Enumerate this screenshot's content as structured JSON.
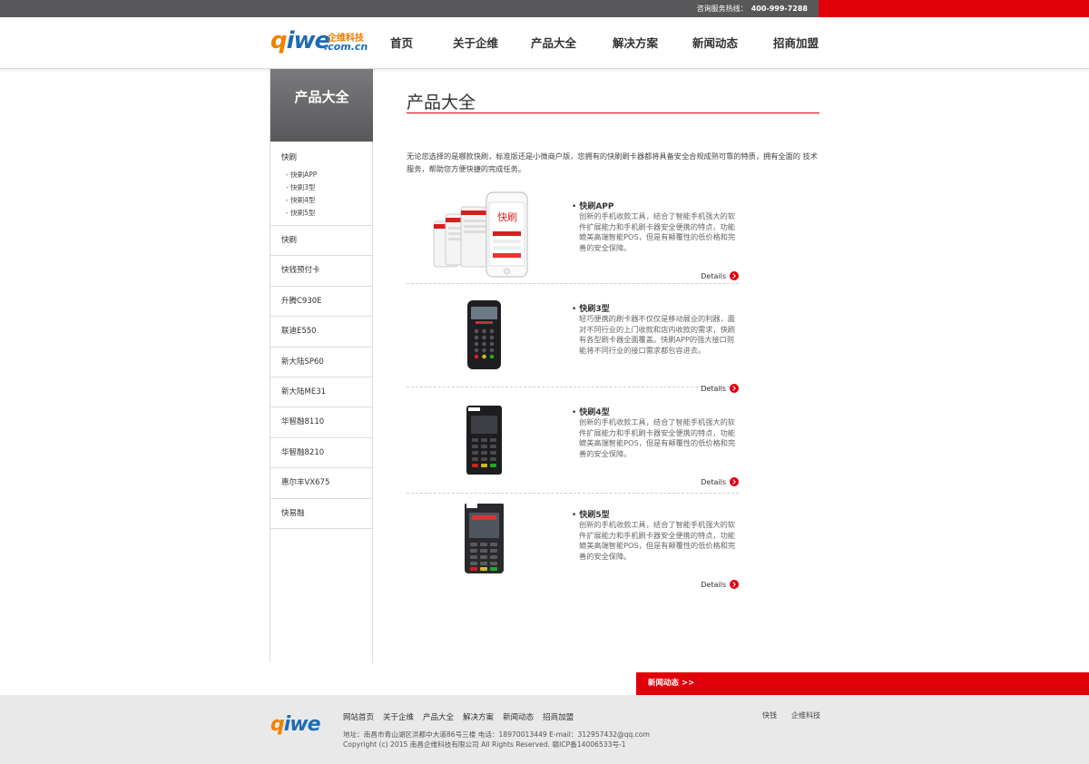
{
  "topbar": {
    "hotline_label": "咨询服务热线：",
    "hotline_number": "400-999-7288"
  },
  "logo": {
    "main": "qiwe",
    "cn": "企维科技",
    "domain": ".com.cn"
  },
  "nav": [
    "首页",
    "关于企维",
    "产品大全",
    "解决方案",
    "新闻动态",
    "招商加盟"
  ],
  "sidebar": {
    "title": "产品大全",
    "group": {
      "title": "快刷",
      "items": [
        "- 快刷APP",
        "- 快刷3型",
        "- 快刷4型",
        "- 快刷5型"
      ]
    },
    "items": [
      "快刷",
      "快钱预付卡",
      "升腾C930E",
      "联迪E550",
      "新大陆SP60",
      "新大陆ME31",
      "华智融8110",
      "华智融8210",
      "惠尔丰VX675",
      "快易融"
    ]
  },
  "main": {
    "title": "产品大全",
    "intro": "无论您选择的是哪款快刷，标准版还是小微商户版，您拥有的快刷刷卡器都将具备安全合规成熟可靠的特质，拥有全面的 技术服务，帮助您方便快捷的完成任务。",
    "products": [
      {
        "name": "快刷APP",
        "desc": "创新的手机收款工具，结合了智能手机强大的软件扩展能力和手机刷卡器安全便携的特点，功能媲美高端智能POS，但是有颠覆性的低价格和完善的安全保障。",
        "details": "Details"
      },
      {
        "name": "快刷3型",
        "desc": "轻巧便携的刷卡器不仅仅是移动展业的利器，面对不同行业的上门收款和店内收款的需求，快刷有各型刷卡器全面覆盖。快刷APP的强大接口则能将不同行业的接口需求都包容进去。",
        "details": "Details"
      },
      {
        "name": "快刷4型",
        "desc": "创新的手机收款工具，结合了智能手机强大的软件扩展能力和手机刷卡器安全便携的特点，功能媲美高端智能POS，但是有颠覆性的低价格和完善的安全保障。",
        "details": "Details"
      },
      {
        "name": "快刷5型",
        "desc": "创新的手机收款工具，结合了智能手机强大的软件扩展能力和手机刷卡器安全便携的特点，功能媲美高端智能POS，但是有颠覆性的低价格和完善的安全保障。",
        "details": "Details"
      }
    ]
  },
  "footer": {
    "news_label": "新闻动态 >>",
    "logo": "qiwe",
    "nav": [
      "网站首页",
      "关于企维",
      "产品大全",
      "解决方案",
      "新闻动态",
      "招商加盟"
    ],
    "address": "地址：南昌市青山湖区洪都中大道86号三楼 电话：18970013449 E-mail：312957432@qq.com",
    "copyright": "Copyright (c) 2015 南昌企维科技有限公司 All Rights Reserved. 赣ICP备14006533号-1",
    "links": [
      "快钱",
      "企维科技"
    ]
  },
  "colors": {
    "accent": "#e0000a",
    "dark": "#58585a",
    "brand_blue": "#1f6bb5",
    "brand_orange": "#f08200"
  }
}
